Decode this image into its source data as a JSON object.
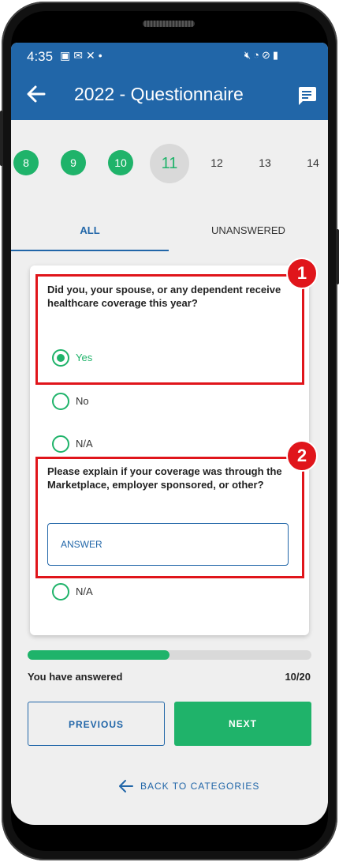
{
  "status_bar": {
    "time": "4:35",
    "left_icons": [
      "image-icon",
      "mail-icon",
      "call-missed-icon",
      "dot-icon"
    ],
    "right_icons": [
      "mute-icon",
      "wifi-icon",
      "do-not-disturb-icon",
      "battery-icon"
    ]
  },
  "app_bar": {
    "title": "2022 - Questionnaire",
    "back_icon": "arrow-left-icon",
    "action_icon": "chat-icon"
  },
  "steps": [
    {
      "label": "8",
      "state": "done"
    },
    {
      "label": "9",
      "state": "done"
    },
    {
      "label": "10",
      "state": "done"
    },
    {
      "label": "11",
      "state": "current"
    },
    {
      "label": "12",
      "state": "todo"
    },
    {
      "label": "13",
      "state": "todo"
    },
    {
      "label": "14",
      "state": "todo"
    }
  ],
  "tabs": {
    "all": "ALL",
    "unanswered": "UNANSWERED",
    "active": "ALL"
  },
  "question1": {
    "text": "Did you, your spouse, or any dependent receive healthcare coverage this year?",
    "options": [
      "Yes",
      "No",
      "N/A"
    ],
    "selected": "Yes"
  },
  "question2": {
    "text": "Please explain if your coverage was through the Marketplace, employer sponsored, or other?",
    "answer_value": "",
    "answer_placeholder": "ANSWER",
    "na_label": "N/A"
  },
  "callouts": [
    "1",
    "2"
  ],
  "progress": {
    "label": "You have answered",
    "count_text": "10/20",
    "answered": 10,
    "total": 20,
    "fraction": 0.5
  },
  "buttons": {
    "previous": "PREVIOUS",
    "next": "NEXT",
    "back_to_categories": "BACK TO CATEGORIES"
  },
  "colors": {
    "primary_blue": "#2166a8",
    "accent_green": "#1fb36a",
    "highlight_red": "#e0151b",
    "screen_bg": "#efefef"
  }
}
